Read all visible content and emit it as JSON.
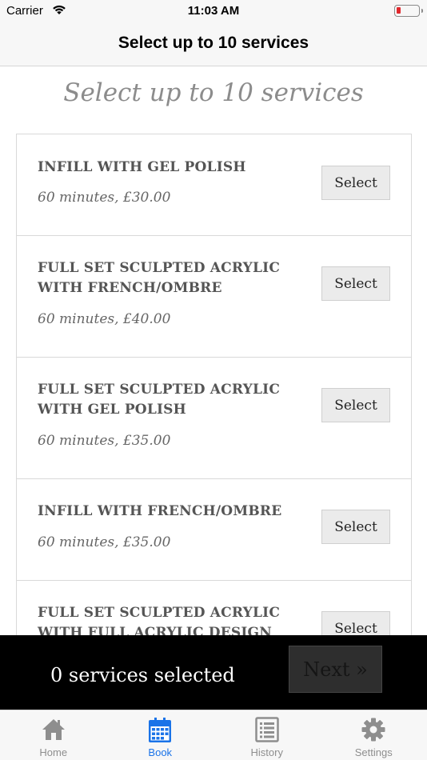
{
  "status_bar": {
    "carrier": "Carrier",
    "time": "11:03 AM"
  },
  "nav": {
    "title": "Select up to 10 services"
  },
  "page": {
    "heading": "Select up to 10 services"
  },
  "services": [
    {
      "name": "INFILL WITH GEL POLISH",
      "meta": "60 minutes, £30.00",
      "button": "Select"
    },
    {
      "name": "FULL SET SCULPTED ACRYLIC WITH FRENCH/OMBRE",
      "meta": "60 minutes, £40.00",
      "button": "Select"
    },
    {
      "name": "FULL SET SCULPTED ACRYLIC WITH GEL POLISH",
      "meta": "60 minutes, £35.00",
      "button": "Select"
    },
    {
      "name": "INFILL WITH FRENCH/OMBRE",
      "meta": "60 minutes, £35.00",
      "button": "Select"
    },
    {
      "name": "FULL SET SCULPTED ACRYLIC WITH FULL ACRYLIC DESIGN",
      "meta": "",
      "button": "Select"
    }
  ],
  "footer": {
    "selected_count": "0 services selected",
    "next_label": "Next »"
  },
  "tabs": [
    {
      "label": "Home",
      "icon": "home-icon",
      "active": false
    },
    {
      "label": "Book",
      "icon": "calendar-icon",
      "active": true
    },
    {
      "label": "History",
      "icon": "list-icon",
      "active": false
    },
    {
      "label": "Settings",
      "icon": "gear-icon",
      "active": false
    }
  ],
  "colors": {
    "accent": "#1a73e8",
    "battery_low": "#e0282d",
    "footer_bg": "#000000"
  }
}
